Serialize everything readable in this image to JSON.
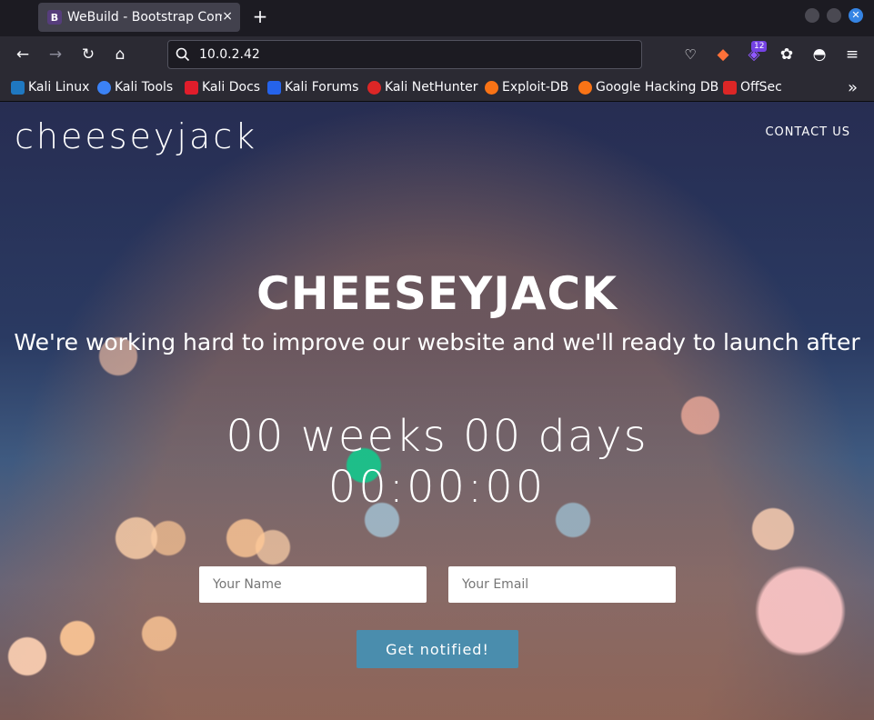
{
  "browser": {
    "tab_title": "WeBuild - Bootstrap Com",
    "tab_favicon": "B",
    "tab_close": "×",
    "new_tab": "+",
    "url": "10.0.2.42",
    "extension_badge": "12",
    "bookmarks": [
      {
        "label": "Kali Linux",
        "icon": "kali-dragon-icon",
        "color": "#1f78c1"
      },
      {
        "label": "Kali Tools",
        "icon": "kali-tools-icon",
        "color": "#3b82f6"
      },
      {
        "label": "Kali Docs",
        "icon": "kali-docs-icon",
        "color": "#e11d2b"
      },
      {
        "label": "Kali Forums",
        "icon": "kali-forums-icon",
        "color": "#2563eb"
      },
      {
        "label": "Kali NetHunter",
        "icon": "nethunter-icon",
        "color": "#dc2626"
      },
      {
        "label": "Exploit-DB",
        "icon": "exploit-db-icon",
        "color": "#f97316"
      },
      {
        "label": "Google Hacking DB",
        "icon": "ghdb-icon",
        "color": "#f97316"
      },
      {
        "label": "OffSec",
        "icon": "offsec-icon",
        "color": "#dc2626"
      }
    ],
    "overflow_label": "»"
  },
  "site": {
    "brand": "cheeseyjack",
    "nav_contact": "CONTACT US",
    "hero_title": "CHEESEYJACK",
    "hero_subtitle": "We're working hard to improve our website and we'll ready to launch after",
    "countdown_line1": "00 weeks 00 days",
    "countdown_line2": "00:00:00",
    "name_placeholder": "Your Name",
    "email_placeholder": "Your Email",
    "notify_button": "Get notified!"
  }
}
